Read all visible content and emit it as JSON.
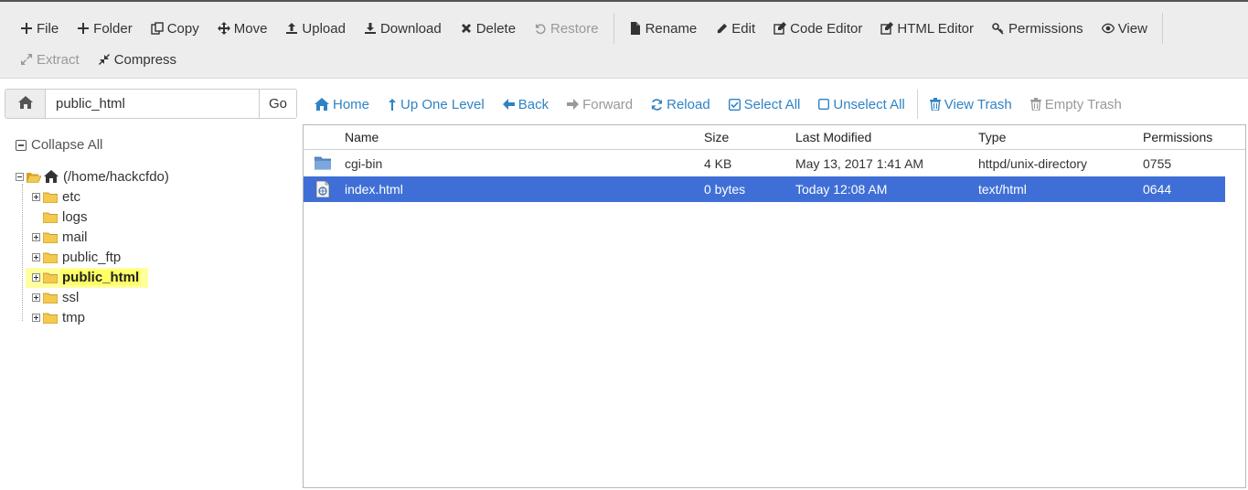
{
  "toolbar": {
    "row1": [
      {
        "label": "File",
        "icon": "plus-icon",
        "disabled": false
      },
      {
        "label": "Folder",
        "icon": "plus-icon",
        "disabled": false
      },
      {
        "label": "Copy",
        "icon": "copy-icon",
        "disabled": false
      },
      {
        "label": "Move",
        "icon": "move-icon",
        "disabled": false
      },
      {
        "label": "Upload",
        "icon": "upload-icon",
        "disabled": false
      },
      {
        "label": "Download",
        "icon": "download-icon",
        "disabled": false
      },
      {
        "label": "Delete",
        "icon": "close-icon",
        "disabled": false
      },
      {
        "label": "Restore",
        "icon": "undo-icon",
        "disabled": true
      },
      {
        "label": "Rename",
        "icon": "file-icon",
        "disabled": false
      },
      {
        "label": "Edit",
        "icon": "pencil-icon",
        "disabled": false
      },
      {
        "label": "Code Editor",
        "icon": "edit-box-icon",
        "disabled": false
      },
      {
        "label": "HTML Editor",
        "icon": "edit-box-icon",
        "disabled": false
      },
      {
        "label": "Permissions",
        "icon": "key-icon",
        "disabled": false
      },
      {
        "label": "View",
        "icon": "eye-icon",
        "disabled": false
      }
    ],
    "row2": [
      {
        "label": "Extract",
        "icon": "expand-icon",
        "disabled": true
      },
      {
        "label": "Compress",
        "icon": "compress-icon",
        "disabled": false
      }
    ]
  },
  "pathbar": {
    "value": "public_html",
    "go_label": "Go"
  },
  "navbar": {
    "home": "Home",
    "up": "Up One Level",
    "back": "Back",
    "forward": "Forward",
    "reload": "Reload",
    "select_all": "Select All",
    "unselect_all": "Unselect All",
    "view_trash": "View Trash",
    "empty_trash": "Empty Trash"
  },
  "tree": {
    "collapse_label": "Collapse All",
    "root": "(/home/hackcfdo)",
    "items": [
      "etc",
      "logs",
      "mail",
      "public_ftp",
      "public_html",
      "ssl",
      "tmp"
    ],
    "selected": "public_html"
  },
  "table": {
    "headers": {
      "name": "Name",
      "size": "Size",
      "modified": "Last Modified",
      "type": "Type",
      "perms": "Permissions"
    },
    "rows": [
      {
        "name": "cgi-bin",
        "size": "4 KB",
        "modified": "May 13, 2017 1:41 AM",
        "type": "httpd/unix-directory",
        "perms": "0755",
        "icon": "folder-icon"
      },
      {
        "name": "index.html",
        "size": "0 bytes",
        "modified": "Today 12:08 AM",
        "type": "text/html",
        "perms": "0644",
        "icon": "html-file-icon"
      }
    ]
  },
  "colors": {
    "accent": "#2f83c5",
    "selection": "#3f6fd6",
    "highlight": "#ffff66"
  }
}
